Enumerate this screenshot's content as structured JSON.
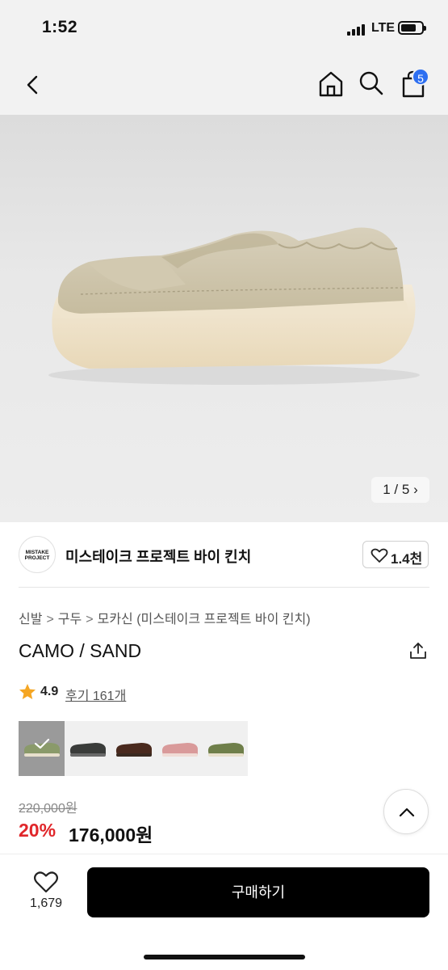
{
  "status_bar": {
    "time": "1:52",
    "network": "LTE"
  },
  "nav": {
    "cart_count": "5"
  },
  "gallery": {
    "counter": "1 / 5",
    "counter_arrow": "›"
  },
  "brand": {
    "logo_line1": "MISTAKE",
    "logo_line2": "PROJECT",
    "name": "미스테이크 프로젝트 바이 킨치",
    "likes": "1.4천"
  },
  "breadcrumb": {
    "items": [
      "신발",
      "구두",
      "모카신 (미스테이크 프로젝트 바이 킨치)"
    ],
    "separator": ">"
  },
  "product": {
    "title": "CAMO / SAND"
  },
  "rating": {
    "value": "4.9",
    "reviews": "후기 161개"
  },
  "swatches": {
    "colors": [
      "#8a9a6a",
      "#3a3c3a",
      "#4a2a1e",
      "#d99a9a",
      "#6f7f4a"
    ],
    "selected_index": 0
  },
  "price": {
    "original": "220,000원",
    "discount": "20%",
    "sale": "176,000원"
  },
  "bottom_bar": {
    "wish_count": "1,679",
    "buy_label": "구매하기"
  },
  "colors": {
    "accent_red": "#e0262a",
    "badge_blue": "#2d6ff1",
    "buy_button": "#000000"
  }
}
